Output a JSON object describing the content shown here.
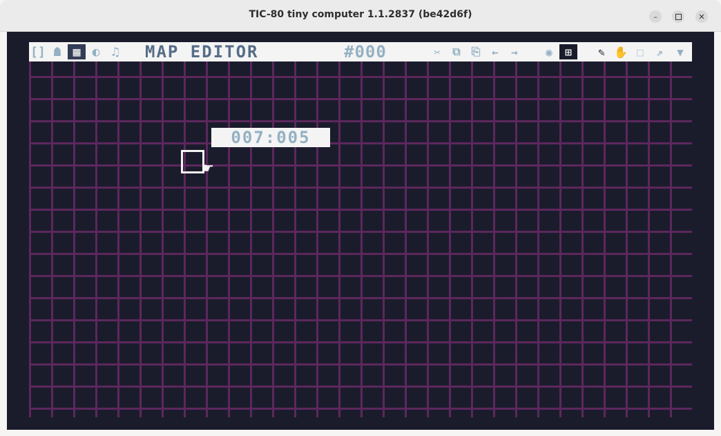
{
  "window": {
    "title": "TIC-80 tiny computer 1.1.2837 (be42d6f)",
    "minimize_glyph": "–",
    "close_glyph": "✕"
  },
  "toolbar": {
    "tabs": [
      {
        "name": "code-editor",
        "glyph": "[]",
        "active": false
      },
      {
        "name": "sprite-editor",
        "glyph": "☗",
        "active": false
      },
      {
        "name": "map-editor",
        "glyph": "▦",
        "active": true
      },
      {
        "name": "sfx-editor",
        "glyph": "◐",
        "active": false
      },
      {
        "name": "music-editor",
        "glyph": "♫",
        "active": false
      }
    ],
    "title": "MAP EDITOR",
    "sprite_index": "#000",
    "tools_left": [
      {
        "name": "cut",
        "glyph": "✂"
      },
      {
        "name": "copy",
        "glyph": "⧉"
      },
      {
        "name": "paste",
        "glyph": "⎘"
      },
      {
        "name": "undo",
        "glyph": "←"
      },
      {
        "name": "redo",
        "glyph": "→"
      }
    ],
    "view_tools": [
      {
        "name": "show-layers",
        "glyph": "◉"
      },
      {
        "name": "grid",
        "glyph": "⊞",
        "active": true
      }
    ],
    "edit_tools": [
      {
        "name": "pencil",
        "glyph": "✎",
        "dark": true
      },
      {
        "name": "hand",
        "glyph": "✋"
      },
      {
        "name": "select",
        "glyph": "⬚"
      },
      {
        "name": "fill",
        "glyph": "⇗"
      },
      {
        "name": "menu",
        "glyph": "▼"
      }
    ]
  },
  "map": {
    "cursor_coords": "007:005",
    "cursor_glyph": "☛"
  },
  "colors": {
    "background": "#1a1c2c",
    "grid_line": "#5d275d",
    "toolbar_bg": "#f4f4f4",
    "toolbar_text": "#94b0c2",
    "title_text": "#566c86"
  }
}
